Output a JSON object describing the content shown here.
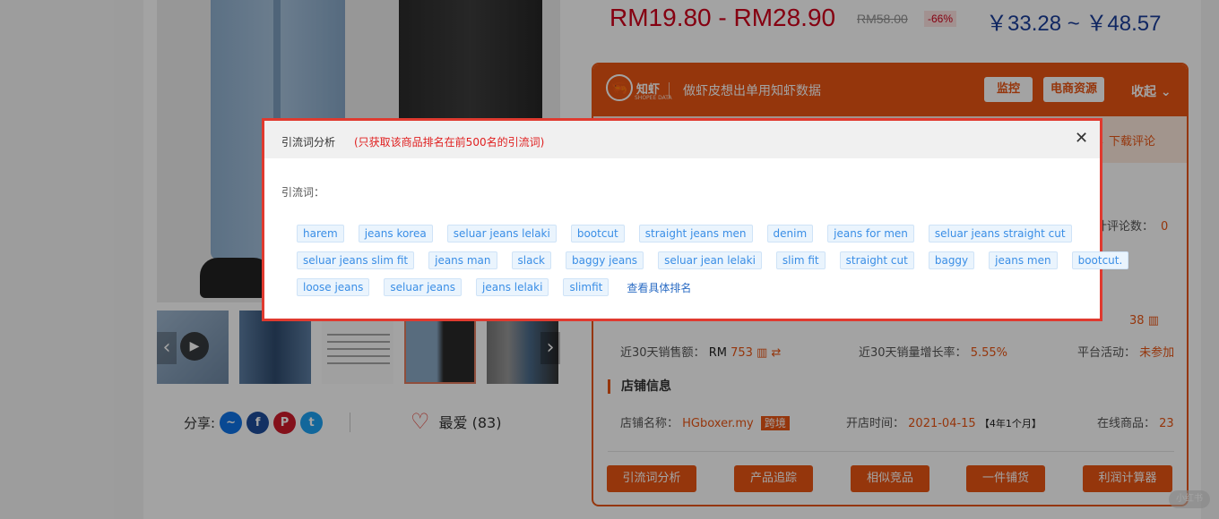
{
  "product": {
    "price_range": "RM19.80 - RM28.90",
    "original_price": "RM58.00",
    "discount": "-66%",
    "price_cny": "￥33.28 ~ ￥48.57",
    "share_label": "分享:",
    "favorite_label": "最爱 (83)"
  },
  "plugin": {
    "logo_text": "知虾",
    "logo_sub": "SHOPEE DATA",
    "slogan": "做虾皮想出单用知虾数据",
    "monitor_button": "监控",
    "ecom_button": "电商资源",
    "collapse_label": "收起",
    "download_reviews": "下载评论",
    "comment_count_label": "计评论数：",
    "comment_count_value": "0",
    "sales_value": "38",
    "sales_30d_label": "近30天销售额：",
    "sales_30d_currency": "RM",
    "sales_30d_value": "753",
    "sales_growth_label": "近30天销量增长率：",
    "sales_growth_value": "5.55%",
    "platform_label": "平台活动：",
    "platform_value": "未参加",
    "shop_section_title": "店铺信息",
    "shop_name_label": "店铺名称：",
    "shop_name_value": "HGboxer.my",
    "cross_border_badge": "跨境",
    "open_time_label": "开店时间：",
    "open_time_value": "2021-04-15",
    "open_time_age": "【4年1个月】",
    "online_products_label": "在线商品：",
    "online_products_value": "23",
    "actions": [
      "引流词分析",
      "产品追踪",
      "相似竞品",
      "一件铺货",
      "利润计算器"
    ],
    "accent_color": "#ea5514"
  },
  "modal": {
    "title": "引流词分析",
    "note": "(只获取该商品排名在前500名的引流词)",
    "keyword_label": "引流词：",
    "keyword_rows": [
      [
        "harem",
        "jeans korea",
        "seluar jeans lelaki",
        "bootcut",
        "straight jeans men",
        "denim",
        "jeans for men",
        "seluar jeans straight cut"
      ],
      [
        "seluar jeans slim fit",
        "jeans man",
        "slack",
        "baggy jeans",
        "seluar jean lelaki",
        "slim fit",
        "straight cut",
        "baggy",
        "jeans men",
        "bootcut."
      ],
      [
        "loose jeans",
        "seluar jeans",
        "jeans lelaki",
        "slimfit"
      ]
    ],
    "view_ranking_link": "查看具体排名",
    "close_icon": "close-icon",
    "border_color": "#e03a2f"
  },
  "watermark": "小红书"
}
